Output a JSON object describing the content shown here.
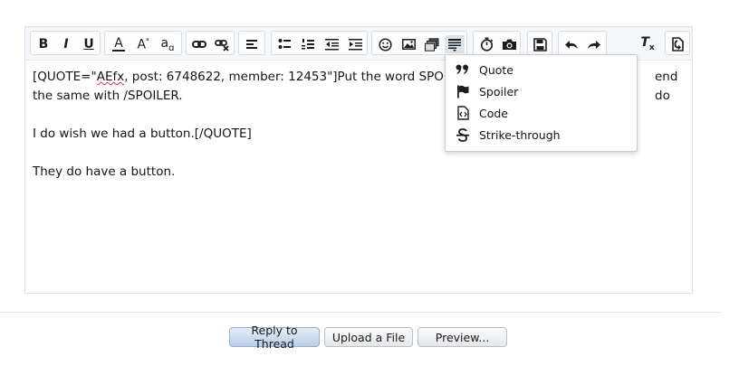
{
  "toolbar": {
    "bold": "B",
    "italic": "I",
    "underline": "U",
    "font_color": "A",
    "font_size": "A",
    "font_size_mark": "ᵃ",
    "font_family": "a",
    "font_family_mark": "ɑ",
    "remove_format": "T"
  },
  "editor": {
    "text_line1_pre": "[QUOTE=\"",
    "text_line1_squiggle": "AEfx",
    "text_line1_post": ", post: 6748622, member: 12453\"]Put the word SPOILER",
    "text_line1_end": "end do",
    "text_line2": "the same with /SPOILER.",
    "text_line3": "I do wish we had a button.[/QUOTE]",
    "text_line4": "They do have a button."
  },
  "dropdown": {
    "items": [
      {
        "label": "Quote",
        "icon": "quote-icon"
      },
      {
        "label": "Spoiler",
        "icon": "flag-icon"
      },
      {
        "label": "Code",
        "icon": "code-file-icon"
      },
      {
        "label": "Strike-through",
        "icon": "strikethrough-icon"
      }
    ]
  },
  "buttons": {
    "reply": "Reply to Thread",
    "upload": "Upload a File",
    "preview": "Preview..."
  },
  "colors": {
    "primary_button": "#b9cfe6",
    "toolbar_bg": "#f5f8fb",
    "editor_border": "#d8e3ee"
  }
}
